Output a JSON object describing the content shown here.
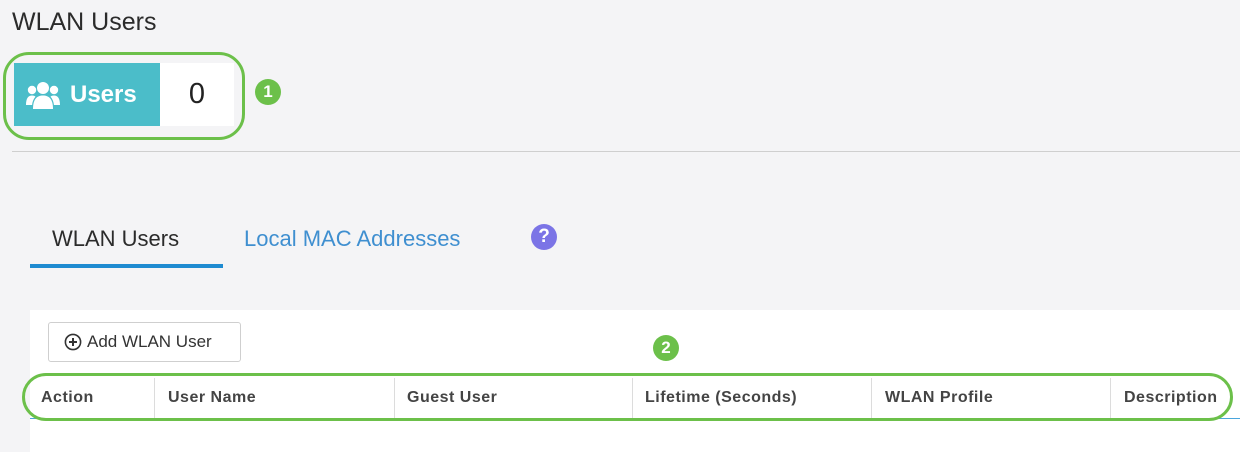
{
  "header": {
    "title": "WLAN Users"
  },
  "users_badge": {
    "label": "Users",
    "count": "0",
    "icon": "users-group-icon"
  },
  "markers": {
    "first": "1",
    "second": "2"
  },
  "tabs": [
    {
      "label": "WLAN Users",
      "active": true
    },
    {
      "label": "Local MAC Addresses",
      "active": false
    }
  ],
  "help": {
    "glyph": "?"
  },
  "toolbar": {
    "add_label": "Add WLAN User",
    "add_icon": "plus-circle-icon"
  },
  "table": {
    "columns": [
      "Action",
      "User Name",
      "Guest User",
      "Lifetime (Seconds)",
      "WLAN Profile",
      "Description"
    ],
    "rows": []
  },
  "colors": {
    "badge": "#4bbdc9",
    "highlight": "#6cc04a",
    "link": "#3f8fd0",
    "tab_underline": "#1e8bd1",
    "help": "#7b74e6"
  }
}
